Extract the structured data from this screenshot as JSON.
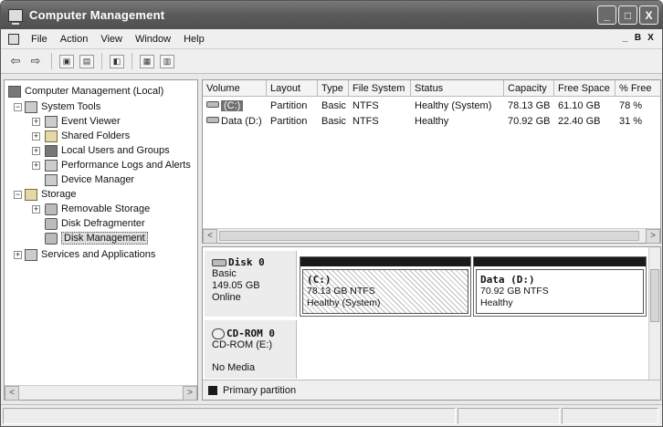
{
  "window": {
    "title": "Computer Management",
    "buttons": [
      "_",
      "□",
      "X"
    ]
  },
  "menu": {
    "items": [
      "File",
      "Action",
      "View",
      "Window",
      "Help"
    ],
    "mdi_buttons": [
      "_",
      "B",
      "X"
    ]
  },
  "toolbar": {
    "back": "⇦",
    "forward": "⇨"
  },
  "tree": {
    "nodes": [
      {
        "label": "Computer Management (Local)",
        "icon": "computer-icon",
        "expander": ""
      },
      {
        "label": "System Tools",
        "icon": "tools-icon",
        "expander": "−"
      },
      {
        "label": "Event Viewer",
        "icon": "event-viewer-icon",
        "expander": "+"
      },
      {
        "label": "Shared Folders",
        "icon": "shared-folders-icon",
        "expander": "+"
      },
      {
        "label": "Local Users and Groups",
        "icon": "users-icon",
        "expander": "+"
      },
      {
        "label": "Performance Logs and Alerts",
        "icon": "performance-icon",
        "expander": "+"
      },
      {
        "label": "Device Manager",
        "icon": "device-manager-icon",
        "expander": ""
      },
      {
        "label": "Storage",
        "icon": "storage-icon",
        "expander": "−"
      },
      {
        "label": "Removable Storage",
        "icon": "removable-storage-icon",
        "expander": "+"
      },
      {
        "label": "Disk Defragmenter",
        "icon": "defrag-icon",
        "expander": ""
      },
      {
        "label": "Disk Management",
        "icon": "disk-management-icon",
        "expander": ""
      },
      {
        "label": "Services and Applications",
        "icon": "services-icon",
        "expander": "+"
      }
    ],
    "selected": "Disk Management",
    "scroll_left": "<",
    "scroll_right": ">"
  },
  "volumes": {
    "columns": [
      "Volume",
      "Layout",
      "Type",
      "File System",
      "Status",
      "Capacity",
      "Free Space",
      "% Free"
    ],
    "rows": [
      {
        "volume": "(C:)",
        "layout": "Partition",
        "type": "Basic",
        "fs": "NTFS",
        "status": "Healthy (System)",
        "capacity": "78.13 GB",
        "free": "61.10 GB",
        "pct": "78 %"
      },
      {
        "volume": "Data (D:)",
        "layout": "Partition",
        "type": "Basic",
        "fs": "NTFS",
        "status": "Healthy",
        "capacity": "70.92 GB",
        "free": "22.40 GB",
        "pct": "31 %"
      }
    ],
    "scroll_left": "<",
    "scroll_right": ">"
  },
  "disks": [
    {
      "name": "Disk 0",
      "type": "Basic",
      "size": "149.05 GB",
      "state": "Online",
      "partitions": [
        {
          "name": "(C:)",
          "size": "78.13 GB NTFS",
          "status": "Healthy (System)",
          "selected": true
        },
        {
          "name": "Data  (D:)",
          "size": "70.92 GB NTFS",
          "status": "Healthy",
          "selected": false
        }
      ]
    },
    {
      "name": "CD-ROM 0",
      "type": "CD-ROM (E:)",
      "media": "No Media"
    }
  ],
  "legend": {
    "label": "Primary partition",
    "color": "#1a1a1a"
  },
  "colors": {
    "title_bar": "#5a5a5a",
    "selection": "#707070"
  }
}
